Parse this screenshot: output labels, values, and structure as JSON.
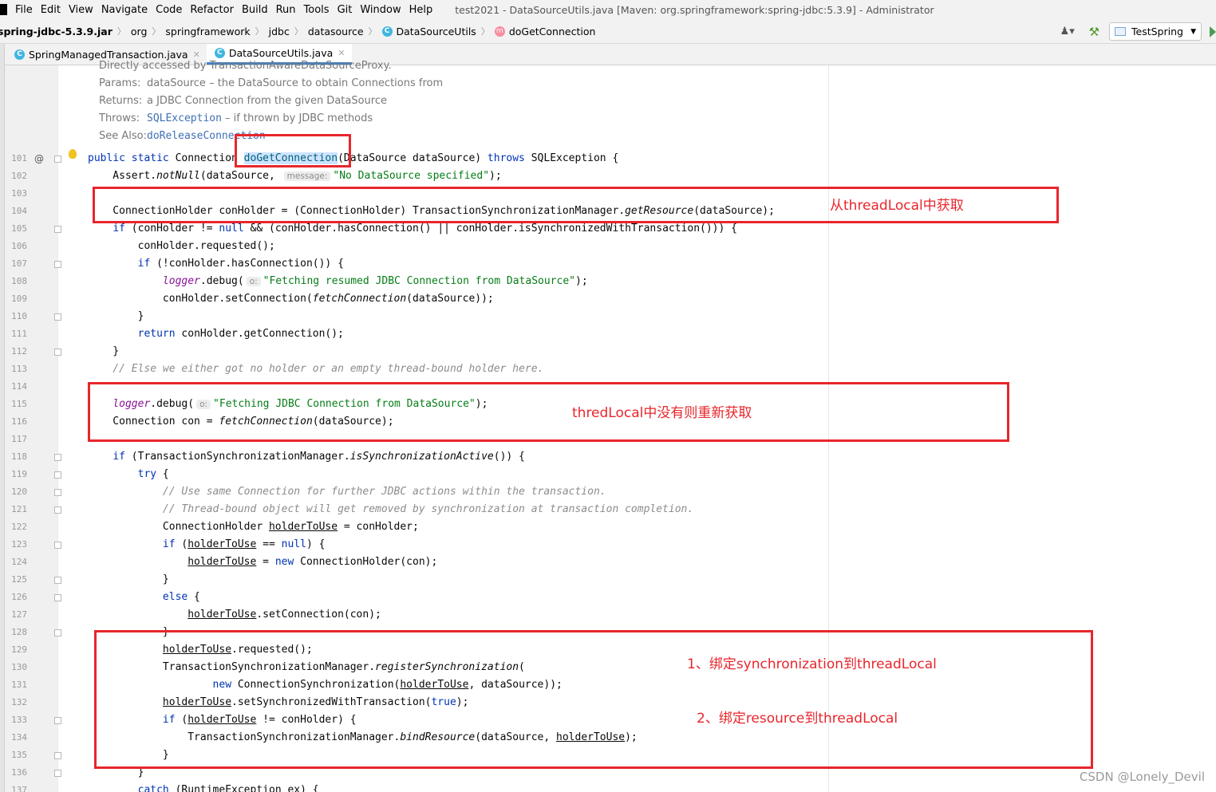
{
  "menubar": {
    "items": [
      "File",
      "Edit",
      "View",
      "Navigate",
      "Code",
      "Refactor",
      "Build",
      "Run",
      "Tools",
      "Git",
      "Window",
      "Help"
    ],
    "window_title": "test2021 - DataSourceUtils.java [Maven: org.springframework:spring-jdbc:5.3.9] - Administrator"
  },
  "breadcrumb": {
    "items": [
      "spring-jdbc-5.3.9.jar",
      "org",
      "springframework",
      "jdbc",
      "datasource",
      "DataSourceUtils",
      "doGetConnection"
    ]
  },
  "toolbar": {
    "run_config": "TestSpring"
  },
  "tabs": [
    {
      "label": "SpringManagedTransaction.java",
      "active": false
    },
    {
      "label": "DataSourceUtils.java",
      "active": true
    }
  ],
  "javadoc": {
    "partial_line": "Directly accessed by TransactionAwareDataSourceProxy.",
    "params_label": "Params:",
    "params_text": "dataSource – the DataSource to obtain Connections from",
    "returns_label": "Returns:",
    "returns_text": "a JDBC Connection from the given DataSource",
    "throws_label": "Throws:",
    "throws_link": "SQLException",
    "throws_text": " – if thrown by JDBC methods",
    "see_label": "See Also:",
    "see_link": "doReleaseConnection"
  },
  "line_numbers": [
    "101",
    "102",
    "103",
    "104",
    "105",
    "106",
    "107",
    "108",
    "109",
    "110",
    "111",
    "112",
    "113",
    "114",
    "115",
    "116",
    "117",
    "118",
    "119",
    "120",
    "121",
    "122",
    "123",
    "124",
    "125",
    "126",
    "127",
    "128",
    "129",
    "130",
    "131",
    "132",
    "133",
    "134",
    "135",
    "136",
    "137"
  ],
  "code": {
    "l101_a": "public static ",
    "l101_b": "Connection ",
    "l101_method": "doGetConnection",
    "l101_c": "(DataSource dataSource) ",
    "l101_throws": "throws",
    "l101_d": " SQLException {",
    "l102_a": "    Assert.",
    "l102_m": "notNull",
    "l102_b": "(dataSource, ",
    "l102_hint": "message:",
    "l102_str": "\"No DataSource specified\"",
    "l102_c": ");",
    "l104_a": "    ConnectionHolder conHolder = (ConnectionHolder) TransactionSynchronizationManager.",
    "l104_m": "getResource",
    "l104_b": "(dataSource);",
    "l105_a": "    ",
    "l105_if": "if",
    "l105_b": " (conHolder != ",
    "l105_null": "null",
    "l105_c": " && (conHolder.hasConnection() || conHolder.isSynchronizedWithTransaction())) {",
    "l106": "        conHolder.requested();",
    "l107_a": "        ",
    "l107_if": "if",
    "l107_b": " (!conHolder.hasConnection()) {",
    "l108_a": "            ",
    "l108_f": "logger",
    "l108_b": ".debug(",
    "l108_hint": "o:",
    "l108_str": "\"Fetching resumed JDBC Connection from DataSource\"",
    "l108_c": ");",
    "l109_a": "            conHolder.setConnection(",
    "l109_m": "fetchConnection",
    "l109_b": "(dataSource));",
    "l110": "        }",
    "l111_a": "        ",
    "l111_ret": "return",
    "l111_b": " conHolder.getConnection();",
    "l112": "    }",
    "l113": "    // Else we either got no holder or an empty thread-bound holder here.",
    "l115_a": "    ",
    "l115_f": "logger",
    "l115_b": ".debug(",
    "l115_hint": "o:",
    "l115_str": "\"Fetching JDBC Connection from DataSource\"",
    "l115_c": ");",
    "l116_a": "    Connection con = ",
    "l116_m": "fetchConnection",
    "l116_b": "(dataSource);",
    "l118_a": "    ",
    "l118_if": "if",
    "l118_b": " (TransactionSynchronizationManager.",
    "l118_m": "isSynchronizationActive",
    "l118_c": "()) {",
    "l119_a": "        ",
    "l119_try": "try",
    "l119_b": " {",
    "l120": "            // Use same Connection for further JDBC actions within the transaction.",
    "l121": "            // Thread-bound object will get removed by synchronization at transaction completion.",
    "l122_a": "            ConnectionHolder ",
    "l122_v": "holderToUse",
    "l122_b": " = conHolder;",
    "l123_a": "            ",
    "l123_if": "if",
    "l123_b": " (",
    "l123_v": "holderToUse",
    "l123_c": " == ",
    "l123_null": "null",
    "l123_d": ") {",
    "l124_a": "                ",
    "l124_v": "holderToUse",
    "l124_b": " = ",
    "l124_new": "new",
    "l124_c": " ConnectionHolder(con);",
    "l125": "            }",
    "l126_a": "            ",
    "l126_else": "else",
    "l126_b": " {",
    "l127_a": "                ",
    "l127_v": "holderToUse",
    "l127_b": ".setConnection(con);",
    "l128": "            }",
    "l129_a": "            ",
    "l129_v": "holderToUse",
    "l129_b": ".requested();",
    "l130_a": "            TransactionSynchronizationManager.",
    "l130_m": "registerSynchronization",
    "l130_b": "(",
    "l131_a": "                    ",
    "l131_new": "new",
    "l131_b": " ConnectionSynchronization(",
    "l131_v": "holderToUse",
    "l131_c": ", dataSource));",
    "l132_a": "            ",
    "l132_v": "holderToUse",
    "l132_b": ".setSynchronizedWithTransaction(",
    "l132_true": "true",
    "l132_c": ");",
    "l133_a": "            ",
    "l133_if": "if",
    "l133_b": " (",
    "l133_v": "holderToUse",
    "l133_c": " != conHolder) {",
    "l134_a": "                TransactionSynchronizationManager.",
    "l134_m": "bindResource",
    "l134_b": "(dataSource, ",
    "l134_v": "holderToUse",
    "l134_c": ");",
    "l135": "            }",
    "l136": "        }",
    "l137_a": "        ",
    "l137_catch": "catch",
    "l137_b": " (RuntimeException ex) {"
  },
  "annotations": {
    "note1": "从threadLocal中获取",
    "note2": "thredLocal中没有则重新获取",
    "note3": "1、绑定synchronization到threadLocal",
    "note4": "2、绑定resource到threadLocal"
  },
  "watermark": "CSDN @Lonely_Devil",
  "colors": {
    "keyword": "#0033b3",
    "string": "#067d17",
    "comment": "#8c8c8c",
    "annotation_red": "#e8262c",
    "active_tab_underline": "#4083c9"
  }
}
